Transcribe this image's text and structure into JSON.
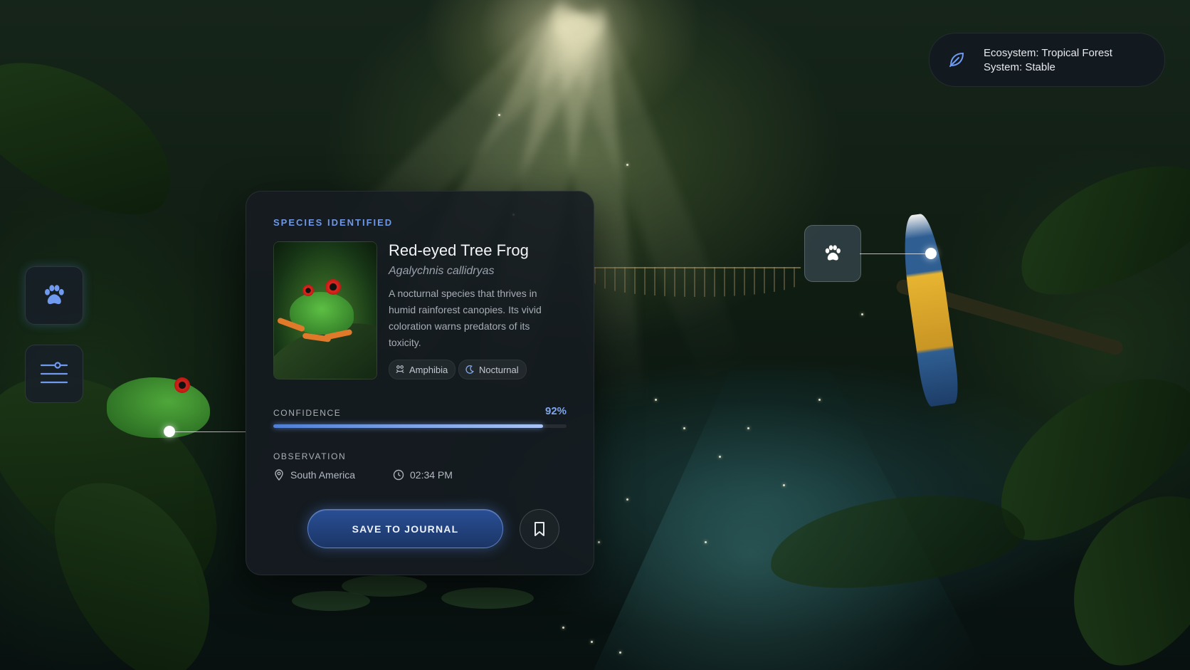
{
  "panel": {
    "eyebrow": "SPECIES IDENTIFIED",
    "common_name": "Red-eyed Tree Frog",
    "scientific_name": "Agalychnis callidryas",
    "description": "A nocturnal species that thrives in humid rainforest canopies. Its vivid coloration warns predators of its toxicity.",
    "tags": [
      {
        "label": "Amphibia",
        "icon": "frog-icon"
      },
      {
        "label": "Nocturnal",
        "icon": "moon-icon"
      }
    ],
    "confidence_label": "CONFIDENCE",
    "confidence_text": "92%",
    "confidence_value": 0.92,
    "observation_label": "OBSERVATION",
    "location": "South America",
    "time": "02:34 PM",
    "save_label": "SAVE TO JOURNAL",
    "bookmark_icon": "bookmark-icon"
  },
  "sidebar": {
    "items": [
      {
        "icon": "paw-icon",
        "active": true
      },
      {
        "icon": "sliders-icon",
        "active": false
      }
    ]
  },
  "status": {
    "icon": "leaf-icon",
    "ecosystem": "Ecosystem: Tropical Forest",
    "system": "System: Stable"
  },
  "hotspots": [
    {
      "icon": "paw-icon"
    }
  ],
  "colors": {
    "accent": "#6e98e6",
    "panel_bg": "#161b21",
    "button": "#1b3566"
  }
}
